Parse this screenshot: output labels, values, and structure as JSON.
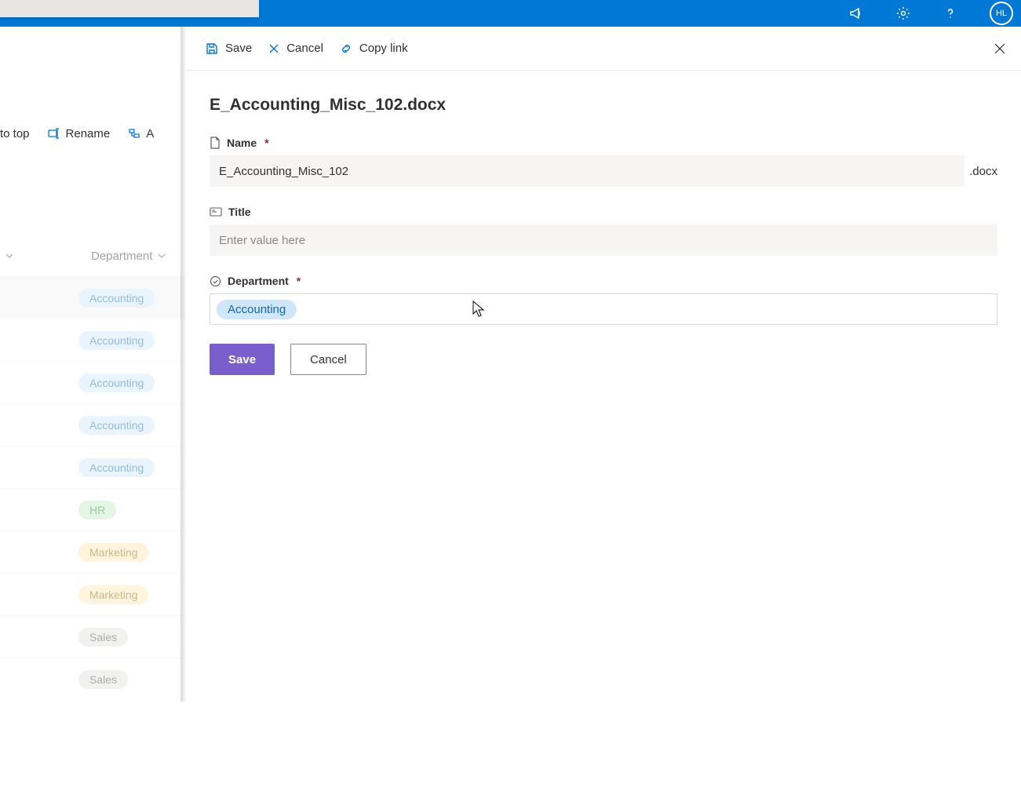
{
  "topbar": {
    "avatar_initials": "HL"
  },
  "under_toolbar": {
    "to_top_fragment": "to top",
    "rename": "Rename",
    "automate_fragment": "A"
  },
  "list": {
    "col_department": "Department",
    "rows": [
      {
        "dept": "Accounting",
        "cls": "accounting"
      },
      {
        "dept": "Accounting",
        "cls": "accounting"
      },
      {
        "dept": "Accounting",
        "cls": "accounting"
      },
      {
        "dept": "Accounting",
        "cls": "accounting"
      },
      {
        "dept": "Accounting",
        "cls": "accounting"
      },
      {
        "dept": "HR",
        "cls": "hr"
      },
      {
        "dept": "Marketing",
        "cls": "marketing"
      },
      {
        "dept": "Marketing",
        "cls": "marketing"
      },
      {
        "dept": "Sales",
        "cls": "sales"
      },
      {
        "dept": "Sales",
        "cls": "sales"
      }
    ]
  },
  "panel": {
    "cmd_save": "Save",
    "cmd_cancel": "Cancel",
    "cmd_copylink": "Copy link",
    "title": "E_Accounting_Misc_102.docx",
    "fields": {
      "name_label": "Name",
      "name_value": "E_Accounting_Misc_102",
      "name_ext": ".docx",
      "title_label": "Title",
      "title_placeholder": "Enter value here",
      "title_value": "",
      "dept_label": "Department",
      "dept_value": "Accounting"
    },
    "btn_save": "Save",
    "btn_cancel": "Cancel"
  }
}
